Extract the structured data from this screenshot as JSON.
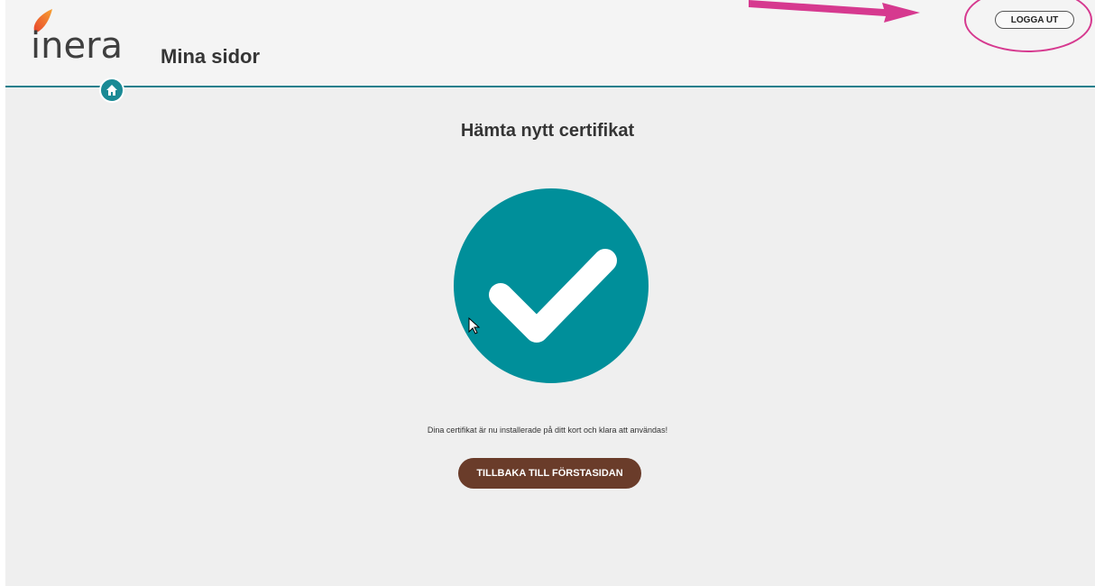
{
  "header": {
    "logo_text": "inera",
    "site_title": "Mina sidor",
    "logout_label": "LOGGA UT"
  },
  "main": {
    "heading": "Hämta nytt certifikat",
    "message": "Dina certifikat är nu installerade på ditt kort och klara att användas!",
    "back_button_label": "TILLBAKA TILL FÖRSTASIDAN"
  },
  "icons": {
    "logo": "inera-drop-logo",
    "home": "home-icon",
    "success": "checkmark-icon",
    "cursor": "mouse-cursor-icon",
    "annotation_arrow": "arrow-icon"
  },
  "colors": {
    "accent_teal": "#008f9a",
    "button_brown": "#6a3c2a",
    "annotation_pink": "#d6398f",
    "logo_orange": "#f07d2a"
  }
}
